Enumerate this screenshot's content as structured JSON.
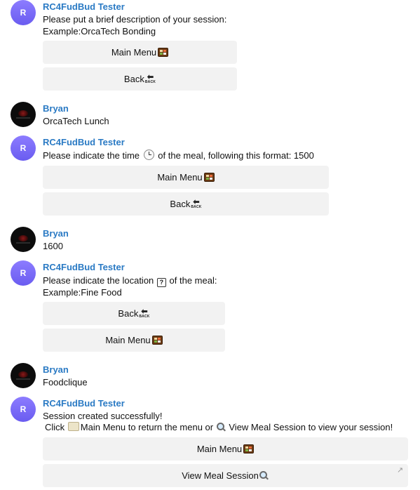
{
  "bot": {
    "name": "RC4FudBud Tester",
    "avatar_letter": "R",
    "accent_color": "#7b6cf6"
  },
  "user": {
    "name": "Bryan",
    "avatar_icon": "user-logo-icon"
  },
  "colors": {
    "sender_name": "#2a7ac4",
    "button_bg": "#f2f2f2"
  },
  "messages": [
    {
      "sender": "RC4FudBud Tester",
      "lines": [
        "Please put a brief description of your session:",
        "Example:OrcaTech Bonding"
      ],
      "buttons": [
        "Main Menu",
        "Back"
      ]
    },
    {
      "sender": "Bryan",
      "lines": [
        "OrcaTech Lunch"
      ]
    },
    {
      "sender": "RC4FudBud Tester",
      "line_pre": "Please indicate the time",
      "line_post": "of the meal, following this format: 1500",
      "buttons": [
        "Main Menu",
        "Back"
      ]
    },
    {
      "sender": "Bryan",
      "lines": [
        "1600"
      ]
    },
    {
      "sender": "RC4FudBud Tester",
      "line_pre": "Please indicate the location",
      "line_post": "of the meal:",
      "lines": [
        "Example:Fine Food"
      ],
      "buttons": [
        "Back",
        "Main Menu"
      ]
    },
    {
      "sender": "Bryan",
      "lines": [
        "Foodclique"
      ]
    },
    {
      "sender": "RC4FudBud Tester",
      "lines": [
        "Session created successfully!"
      ],
      "line2_click": "Click",
      "line2_mid": "Main Menu to return the menu or",
      "line2_end": "View Meal Session to view your session!",
      "buttons": [
        "Main Menu",
        "View Meal Session"
      ]
    }
  ],
  "icons": {
    "bento": "bento-box-icon",
    "back_arrow": "back-arrow-icon",
    "back_label": "BACK",
    "clock": "clock-icon",
    "question": "question-box-icon",
    "question_glyph": "?",
    "scroll": "scroll-icon",
    "magnify": "magnifying-glass-icon",
    "expand": "↗"
  }
}
